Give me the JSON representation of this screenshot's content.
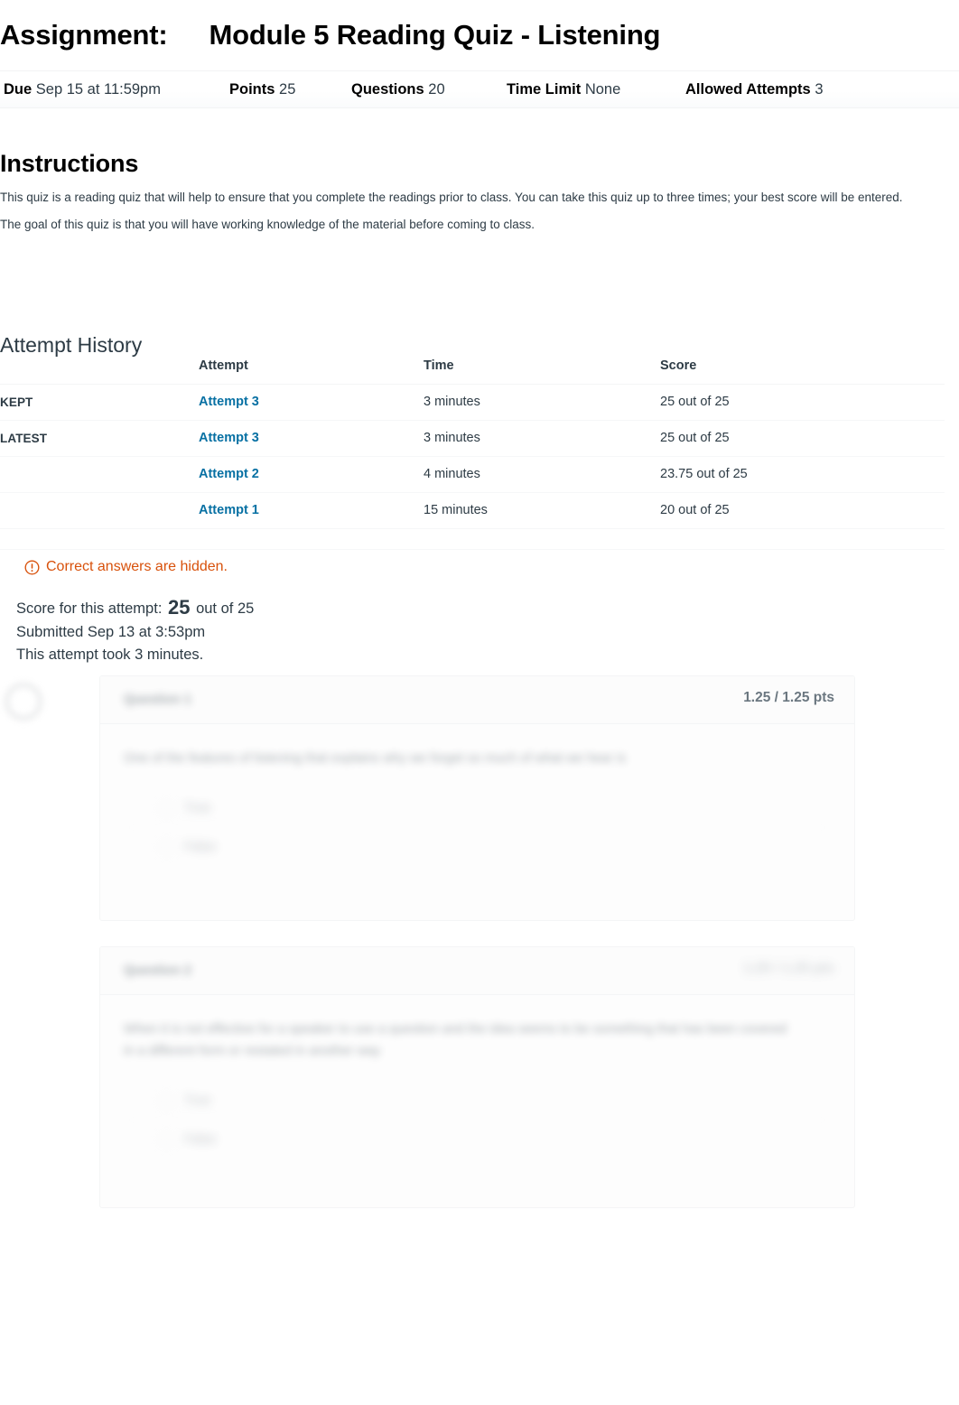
{
  "page": {
    "title_label": "Assignment:",
    "title_name": "Module 5 Reading Quiz - Listening"
  },
  "meta": {
    "due_key": "Due",
    "due_value": "Sep 15 at 11:59pm",
    "points_key": "Points",
    "points_value": "25",
    "questions_key": "Questions",
    "questions_value": "20",
    "time_limit_key": "Time Limit",
    "time_limit_value": "None",
    "allowed_attempts_key": "Allowed Attempts",
    "allowed_attempts_value": "3"
  },
  "instructions": {
    "heading": "Instructions",
    "paragraph_1": "This quiz is a reading quiz that will help to ensure that you complete the readings prior to class. You can take this quiz up to three times; your best score will be entered.",
    "paragraph_2": "The goal of this quiz is that you will have working knowledge of the material before coming to class."
  },
  "attempt_history": {
    "heading": "Attempt History",
    "columns": {
      "flag": "",
      "attempt": "Attempt",
      "time": "Time",
      "score": "Score"
    },
    "rows": [
      {
        "flag": "KEPT",
        "attempt": "Attempt 3",
        "time": "3 minutes",
        "score": "25 out of 25"
      },
      {
        "flag": "LATEST",
        "attempt": "Attempt 3",
        "time": "3 minutes",
        "score": "25 out of 25"
      },
      {
        "flag": "",
        "attempt": "Attempt 2",
        "time": "4 minutes",
        "score": "23.75 out of 25"
      },
      {
        "flag": "",
        "attempt": "Attempt 1",
        "time": "15 minutes",
        "score": "20 out of 25"
      }
    ]
  },
  "notice": {
    "icon": "warning-circle-icon",
    "text": "Correct answers are hidden.",
    "color": "#D8510B"
  },
  "score_summary": {
    "score_prefix": "Score for this attempt:",
    "score_value": "25",
    "score_suffix": "out of 25",
    "submitted": "Submitted Sep 13 at 3:53pm",
    "duration": "This attempt took 3 minutes."
  },
  "questions": [
    {
      "name": "Question 1",
      "points": "1.25 / 1.25 pts",
      "redacted": true,
      "text": "One of the features of listening that explains why we forget so much of what we hear is",
      "answers": [
        {
          "label": "True",
          "selected": false
        },
        {
          "label": "False",
          "selected": false
        }
      ]
    },
    {
      "name": "Question 2",
      "points": "1.25 / 1.25 pts",
      "redacted": true,
      "text": "When it is not effective for a speaker to use a question and the idea seems to be something that has been covered in a different form or restated in another way",
      "answers": [
        {
          "label": "True",
          "selected": false
        },
        {
          "label": "False",
          "selected": true
        }
      ]
    }
  ],
  "colors": {
    "link": "#0770A3",
    "warning": "#D8510B",
    "text": "#2d3b45",
    "muted": "#6b7780"
  }
}
